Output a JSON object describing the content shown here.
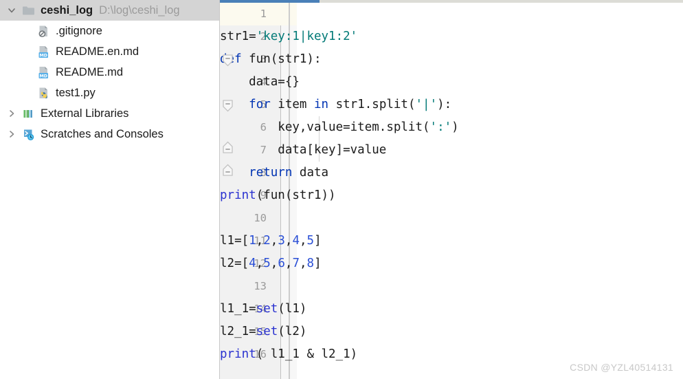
{
  "window": {
    "watermark": "CSDN @YZL40514131"
  },
  "sidebar": {
    "project": {
      "name": "ceshi_log",
      "path": "D:\\log\\ceshi_log",
      "icon": "folder-icon",
      "expand_icon": "chevron-down-icon",
      "expanded": true,
      "selected": true
    },
    "files": [
      {
        "label": ".gitignore",
        "icon": "gitignore-file-icon",
        "indent": 2
      },
      {
        "label": "README.en.md",
        "icon": "markdown-file-icon",
        "indent": 2
      },
      {
        "label": "README.md",
        "icon": "markdown-file-icon",
        "indent": 2
      },
      {
        "label": "test1.py",
        "icon": "python-file-icon",
        "indent": 2
      }
    ],
    "nodes": [
      {
        "label": "External Libraries",
        "icon": "external-libraries-icon",
        "expand_icon": "chevron-right-icon",
        "indent": 1
      },
      {
        "label": "Scratches and Consoles",
        "icon": "scratches-consoles-icon",
        "expand_icon": "chevron-right-icon",
        "indent": 1
      }
    ]
  },
  "editor": {
    "caret_line": 1,
    "line_numbers": [
      1,
      2,
      3,
      4,
      5,
      6,
      7,
      8,
      9,
      10,
      11,
      12,
      13,
      14,
      15,
      16
    ],
    "fold_markers": [
      {
        "line": 3,
        "type": "fold-collapse-start-icon"
      },
      {
        "line": 5,
        "type": "fold-collapse-start-icon"
      },
      {
        "line": 7,
        "type": "fold-collapse-end-icon"
      },
      {
        "line": 8,
        "type": "fold-collapse-end-icon"
      }
    ],
    "colors": {
      "keyword": "#0033b3",
      "string": "#027a77",
      "number": "#2a4fd6",
      "builtin": "#2a32d0",
      "text": "#1b1b1b",
      "gutter_bg": "#f1f1f1",
      "caret_line_bg": "#fcfaef",
      "accent": "#4a80b8"
    },
    "lines": [
      {
        "n": 1,
        "text": ""
      },
      {
        "n": 2,
        "text": "str1='key:1|key1:2'"
      },
      {
        "n": 3,
        "text": "def fun(str1):"
      },
      {
        "n": 4,
        "text": "    data={}"
      },
      {
        "n": 5,
        "text": "    for item in str1.split('|'):"
      },
      {
        "n": 6,
        "text": "        key,value=item.split(':')"
      },
      {
        "n": 7,
        "text": "        data[key]=value"
      },
      {
        "n": 8,
        "text": "    return data"
      },
      {
        "n": 9,
        "text": "print(fun(str1))"
      },
      {
        "n": 10,
        "text": ""
      },
      {
        "n": 11,
        "text": "l1=[1,2,3,4,5]"
      },
      {
        "n": 12,
        "text": "l2=[4,5,6,7,8]"
      },
      {
        "n": 13,
        "text": ""
      },
      {
        "n": 14,
        "text": "l1_1=set(l1)"
      },
      {
        "n": 15,
        "text": "l2_1=set(l2)"
      },
      {
        "n": 16,
        "text": "print( l1_1 & l2_1)"
      }
    ],
    "tokens": {
      "l2": [
        {
          "t": "str1=",
          "c": "text"
        },
        {
          "t": "'key:1|key1:2'",
          "c": "string"
        }
      ],
      "l3": [
        {
          "t": "def",
          "c": "keyword"
        },
        {
          "t": " fun(str1):",
          "c": "text"
        }
      ],
      "l4": [
        {
          "t": "    data={}",
          "c": "text"
        }
      ],
      "l5": [
        {
          "t": "    ",
          "c": "text"
        },
        {
          "t": "for",
          "c": "keyword"
        },
        {
          "t": " item ",
          "c": "text"
        },
        {
          "t": "in",
          "c": "keyword"
        },
        {
          "t": " str1.split(",
          "c": "text"
        },
        {
          "t": "'|'",
          "c": "string"
        },
        {
          "t": "):",
          "c": "text"
        }
      ],
      "l6": [
        {
          "t": "        key,value=item.split(",
          "c": "text"
        },
        {
          "t": "':'",
          "c": "string"
        },
        {
          "t": ")",
          "c": "text"
        }
      ],
      "l7": [
        {
          "t": "        data[key]=value",
          "c": "text"
        }
      ],
      "l8": [
        {
          "t": "    ",
          "c": "text"
        },
        {
          "t": "return",
          "c": "keyword"
        },
        {
          "t": " data",
          "c": "text"
        }
      ],
      "l9": [
        {
          "t": "print",
          "c": "builtin"
        },
        {
          "t": "(fun(str1))",
          "c": "text"
        }
      ],
      "l11": [
        {
          "t": "l1=[",
          "c": "text"
        },
        {
          "t": "1",
          "c": "number"
        },
        {
          "t": ",",
          "c": "text"
        },
        {
          "t": "2",
          "c": "number"
        },
        {
          "t": ",",
          "c": "text"
        },
        {
          "t": "3",
          "c": "number"
        },
        {
          "t": ",",
          "c": "text"
        },
        {
          "t": "4",
          "c": "number"
        },
        {
          "t": ",",
          "c": "text"
        },
        {
          "t": "5",
          "c": "number"
        },
        {
          "t": "]",
          "c": "text"
        }
      ],
      "l12": [
        {
          "t": "l2=[",
          "c": "text"
        },
        {
          "t": "4",
          "c": "number"
        },
        {
          "t": ",",
          "c": "text"
        },
        {
          "t": "5",
          "c": "number"
        },
        {
          "t": ",",
          "c": "text"
        },
        {
          "t": "6",
          "c": "number"
        },
        {
          "t": ",",
          "c": "text"
        },
        {
          "t": "7",
          "c": "number"
        },
        {
          "t": ",",
          "c": "text"
        },
        {
          "t": "8",
          "c": "number"
        },
        {
          "t": "]",
          "c": "text"
        }
      ],
      "l14": [
        {
          "t": "l1_1=",
          "c": "text"
        },
        {
          "t": "set",
          "c": "builtin"
        },
        {
          "t": "(l1)",
          "c": "text"
        }
      ],
      "l15": [
        {
          "t": "l2_1=",
          "c": "text"
        },
        {
          "t": "set",
          "c": "builtin"
        },
        {
          "t": "(l2)",
          "c": "text"
        }
      ],
      "l16": [
        {
          "t": "print",
          "c": "builtin"
        },
        {
          "t": "( l1_1 & l2_1)",
          "c": "text"
        }
      ]
    }
  }
}
